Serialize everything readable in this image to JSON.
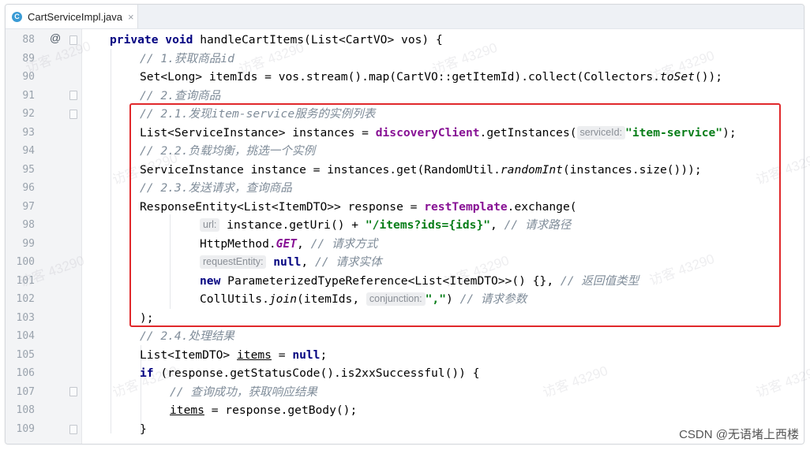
{
  "tab": {
    "icon_label": "C",
    "title": "CartServiceImpl.java",
    "close": "×"
  },
  "gutter": {
    "annotation_symbol": "@"
  },
  "lines": {
    "l88": {
      "num": "88",
      "kw": "private void ",
      "rest": "handleCartItems(List<CartVO> vos) {"
    },
    "l89": {
      "num": "89",
      "c": "// 1.获取商品id"
    },
    "l90": {
      "num": "90",
      "a": "Set<Long> itemIds = vos.stream().map(CartVO::getItemId).collect(Collectors.",
      "b": "toSet",
      "d": "());"
    },
    "l91": {
      "num": "91",
      "c": "// 2.查询商品"
    },
    "l92": {
      "num": "92",
      "c": "// 2.1.发现item-service服务的实例列表"
    },
    "l93": {
      "num": "93",
      "a": "List<ServiceInstance> instances = ",
      "f": "discoveryClient",
      "b": ".getInstances(",
      "h": "serviceId:",
      "s": "\"item-service\"",
      "d": ");"
    },
    "l94": {
      "num": "94",
      "c": "// 2.2.负载均衡，挑选一个实例"
    },
    "l95": {
      "num": "95",
      "a": "ServiceInstance instance = instances.get(RandomUtil.",
      "b": "randomInt",
      "d": "(instances.size()));"
    },
    "l96": {
      "num": "96",
      "c": "// 2.3.发送请求，查询商品"
    },
    "l97": {
      "num": "97",
      "a": "ResponseEntity<List<ItemDTO>> response = ",
      "f": "restTemplate",
      "d": ".exchange("
    },
    "l98": {
      "num": "98",
      "h": "url:",
      "a": " instance.getUri() + ",
      "s": "\"/items?ids={ids}\"",
      "d": ", ",
      "c": "// 请求路径"
    },
    "l99": {
      "num": "99",
      "a": "HttpMethod.",
      "k": "GET",
      "d": ", ",
      "c": "// 请求方式"
    },
    "l100": {
      "num": "100",
      "h": "requestEntity:",
      "kw": " null",
      "d": ", ",
      "c": "// 请求实体"
    },
    "l101": {
      "num": "101",
      "kw": "new ",
      "a": "ParameterizedTypeReference<List<ItemDTO>>() {}, ",
      "c": "// 返回值类型"
    },
    "l102": {
      "num": "102",
      "a": "CollUtils.",
      "b": "join",
      "d": "(itemIds, ",
      "h": "conjunction:",
      "s": "\",\"",
      "e": ") ",
      "c": "// 请求参数"
    },
    "l103": {
      "num": "103",
      "a": ");"
    },
    "l104": {
      "num": "104",
      "c": "// 2.4.处理结果"
    },
    "l105": {
      "num": "105",
      "a": "List<ItemDTO> ",
      "u": "items",
      "d": " = ",
      "kw": "null",
      "e": ";"
    },
    "l106": {
      "num": "106",
      "kw": "if ",
      "a": "(response.getStatusCode().is2xxSuccessful()) {"
    },
    "l107": {
      "num": "107",
      "c": "// 查询成功，获取响应结果"
    },
    "l108": {
      "num": "108",
      "u": "items",
      "a": " = response.getBody();"
    },
    "l109": {
      "num": "109",
      "a": "}"
    }
  },
  "watermarks": [
    "访客 43290",
    "访客 43290",
    "访客 43290",
    "访客 43290",
    "访客 43290",
    "访客 43290",
    "访客 43290",
    "访客 43290",
    "访客 43290",
    "访客 43290",
    "访客 43290",
    "访客 43290"
  ],
  "credit": "CSDN @无语堵上西楼",
  "colors": {
    "highlight_box": "#e0282b",
    "keyword": "#000080",
    "string": "#067d17",
    "field": "#871094",
    "comment": "#7f8c99"
  }
}
